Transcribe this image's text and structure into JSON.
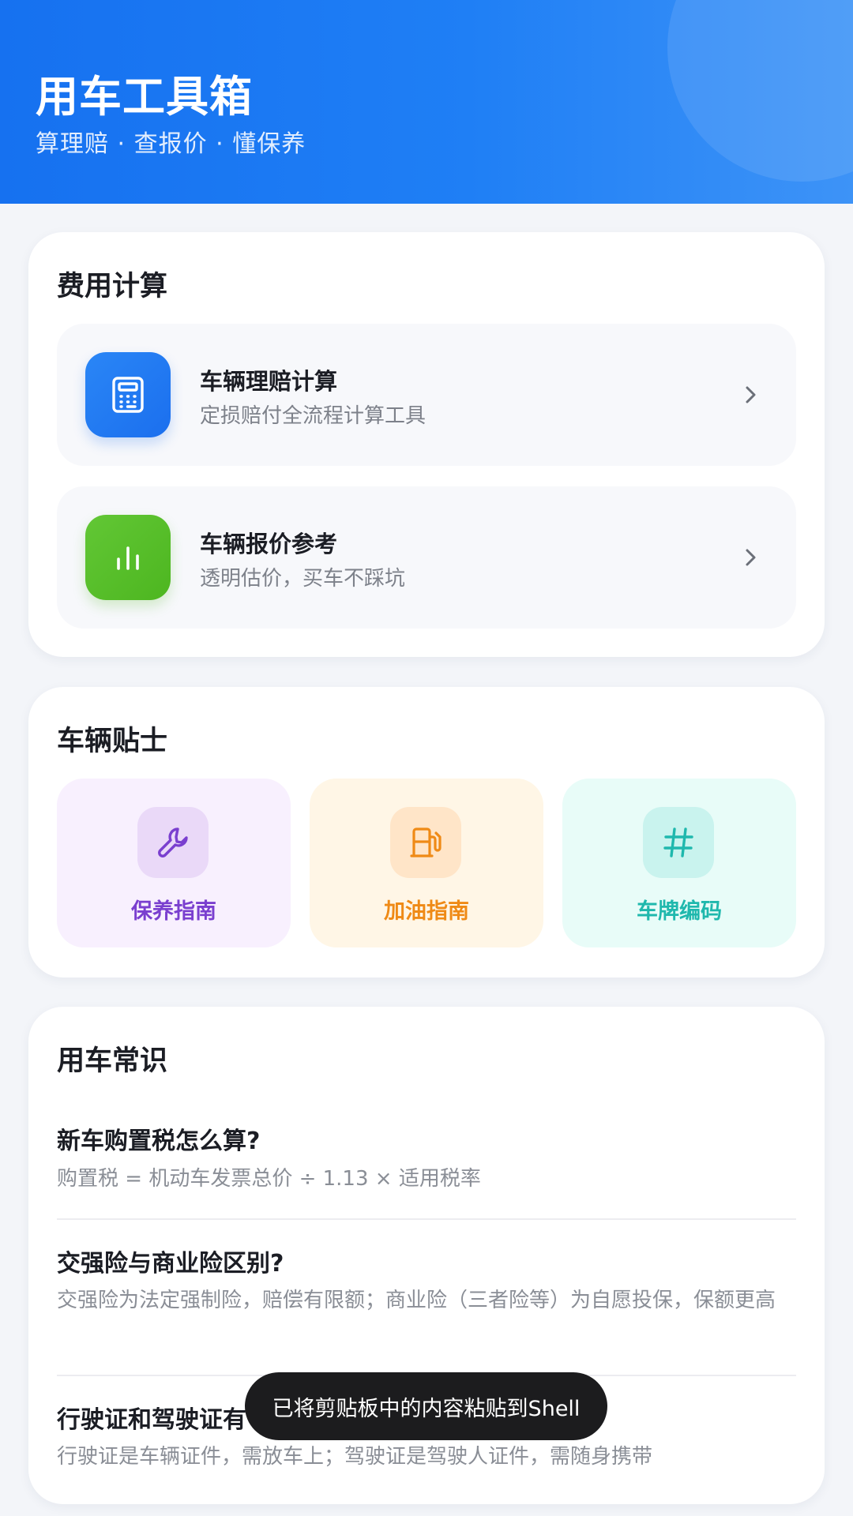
{
  "header": {
    "title": "用车工具箱",
    "subtitle": "算理赔 · 查报价 · 懂保养"
  },
  "cost_section": {
    "title": "费用计算",
    "items": [
      {
        "title": "车辆理赔计算",
        "desc": "定损赔付全流程计算工具",
        "icon": "calculator-icon",
        "color": "#1f78f2"
      },
      {
        "title": "车辆报价参考",
        "desc": "透明估价，买车不踩坑",
        "icon": "bar-chart-icon",
        "color": "#55bd28"
      }
    ]
  },
  "tips_section": {
    "title": "车辆贴士",
    "items": [
      {
        "label": "保养指南",
        "icon": "wrench-icon",
        "color": "#7a3fcf",
        "bg": "#f8f0fe",
        "icon_bg": "#ead9f8"
      },
      {
        "label": "加油指南",
        "icon": "fuel-pump-icon",
        "color": "#ef8a16",
        "bg": "#fff6e6",
        "icon_bg": "#ffe5c8"
      },
      {
        "label": "车牌编码",
        "icon": "hash-icon",
        "color": "#1fb8ad",
        "bg": "#e8fcf8",
        "icon_bg": "#c9f3ee"
      }
    ]
  },
  "knowledge_section": {
    "title": "用车常识",
    "items": [
      {
        "question": "新车购置税怎么算?",
        "answer": "购置税 = 机动车发票总价 ÷ 1.13 × 适用税率"
      },
      {
        "question": "交强险与商业险区别?",
        "answer": "交强险为法定强制险，赔偿有限额；商业险（三者险等）为自愿投保，保额更高"
      },
      {
        "question": "行驶证和驾驶证有",
        "answer": "行驶证是车辆证件，需放车上；驾驶证是驾驶人证件，需随身携带"
      }
    ]
  },
  "toast": {
    "text": "已将剪贴板中的内容粘贴到Shell"
  }
}
